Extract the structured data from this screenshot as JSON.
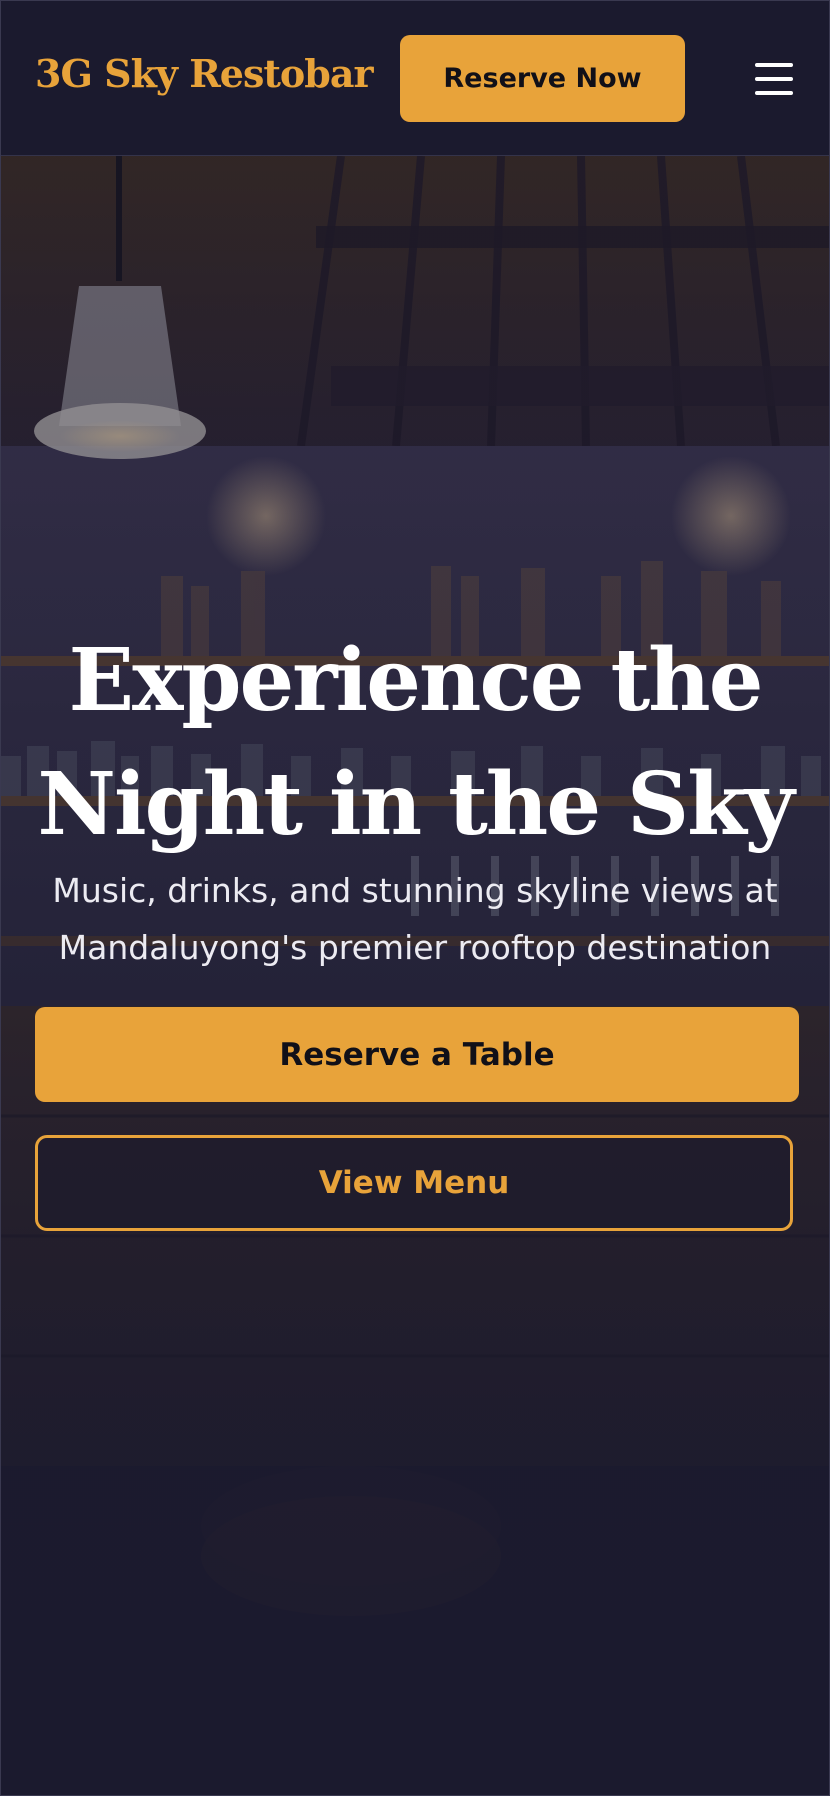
{
  "header": {
    "logo_text": "3G Sky Restobar",
    "reserve_label": "Reserve Now",
    "menu_icon": "hamburger-menu-icon"
  },
  "hero": {
    "headline_line1": "Experience the",
    "headline_line2": "Night in the Sky",
    "subheadline_line1": "Music, drinks, and stunning skyline views at",
    "subheadline_line2": "Mandaluyong's premier rooftop destination",
    "primary_cta": "Reserve a Table",
    "secondary_cta": "View Menu"
  },
  "colors": {
    "accent": "#e8a33a",
    "background": "#1b1a2e",
    "text": "#ffffff"
  }
}
